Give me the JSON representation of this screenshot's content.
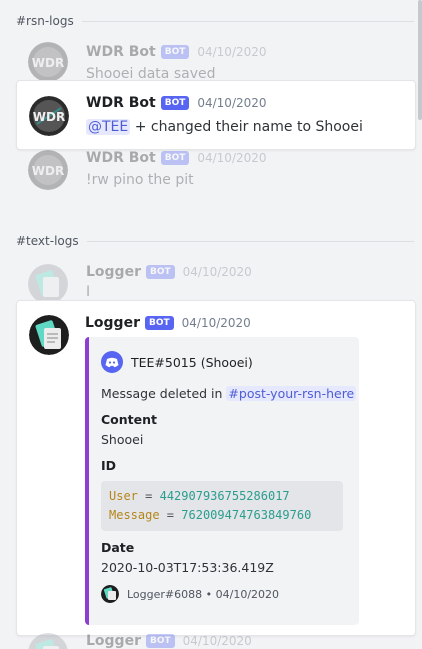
{
  "channels": {
    "rsn_logs": "#rsn-logs",
    "text_logs": "#text-logs"
  },
  "bot_tag": "BOT",
  "messages": {
    "wdr_1": {
      "author": "WDR Bot",
      "timestamp": "04/10/2020",
      "content": "Shooei data saved"
    },
    "wdr_2": {
      "author": "WDR Bot",
      "timestamp": "04/10/2020",
      "mention": "@TEE",
      "content": " + changed their name to Shooei"
    },
    "wdr_3": {
      "author": "WDR Bot",
      "timestamp": "04/10/2020",
      "content": "!rw pino the pit"
    },
    "logger_1": {
      "author": "Logger",
      "timestamp": "04/10/2020",
      "content": "I"
    },
    "logger_2": {
      "author": "Logger",
      "timestamp": "04/10/2020",
      "embed": {
        "author": "TEE#5015 (Shooei)",
        "desc_prefix": "Message deleted in ",
        "channel": "#post-your-rsn-here",
        "content_label": "Content",
        "content_value": "Shooei",
        "id_label": "ID",
        "code": {
          "user_key": "User",
          "user_value": "442907936755286017",
          "message_key": "Message",
          "message_value": "762009474763849760"
        },
        "date_label": "Date",
        "date_value": "2020-10-03T17:53:36.419Z",
        "footer": "Logger#6088 • 04/10/2020"
      }
    },
    "logger_3": {
      "author": "Logger",
      "timestamp": "04/10/2020"
    }
  },
  "colors": {
    "accent": "#5865f2",
    "embed_bar": "#8e3fd1",
    "mention_bg": "#e6e9fd",
    "logger_avatar": "#5fd8c4"
  }
}
